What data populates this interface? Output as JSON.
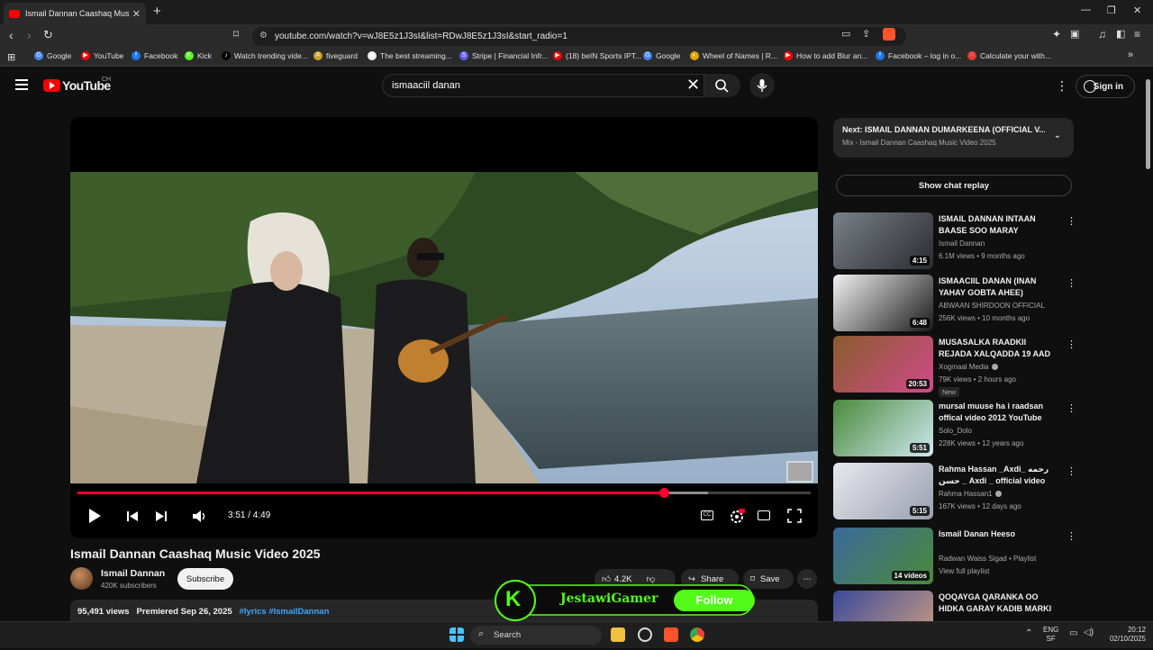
{
  "browser": {
    "tab_title": "Ismail Dannan Caashaq Music Vi",
    "new_tab": "+",
    "win_min": "—",
    "win_max": "❐",
    "win_close": "✕",
    "url": "youtube.com/watch?v=wJ8E5z1J3sI&list=RDwJ8E5z1J3sI&start_radio=1",
    "bookmarks": [
      {
        "label": "Google",
        "color": "#4285f4",
        "glyph": "G"
      },
      {
        "label": "YouTube",
        "color": "#ff0000",
        "glyph": "▶"
      },
      {
        "label": "Facebook",
        "color": "#1877f2",
        "glyph": "f"
      },
      {
        "label": "Kick",
        "color": "#53fc18",
        "glyph": "K"
      },
      {
        "label": "Watch trending vide...",
        "color": "#000000",
        "glyph": "♪"
      },
      {
        "label": "fiveguard",
        "color": "#c9a227",
        "glyph": "#"
      },
      {
        "label": "The best streaming...",
        "color": "#eeeeee",
        "glyph": "◆"
      },
      {
        "label": "Stripe | Financial Infr...",
        "color": "#635bff",
        "glyph": "S"
      },
      {
        "label": "(18) beIN Sports IPT...",
        "color": "#ff0000",
        "glyph": "▶"
      },
      {
        "label": "Google",
        "color": "#4285f4",
        "glyph": "G"
      },
      {
        "label": "Wheel of Names | R...",
        "color": "#e0a800",
        "glyph": "◐"
      },
      {
        "label": "How to add Blur an...",
        "color": "#ff0000",
        "glyph": "▶"
      },
      {
        "label": "Facebook – log in o...",
        "color": "#1877f2",
        "glyph": "f"
      },
      {
        "label": "Calculate your with...",
        "color": "#e53935",
        "glyph": "⁙"
      }
    ],
    "more_bookmarks": "»"
  },
  "youtube": {
    "logo_text": "YouTube",
    "country": "CH",
    "search_value": "ismaaciil danan",
    "sign_in": "Sign in"
  },
  "player": {
    "time": "3:51 / 4:49",
    "progress_fraction": 0.8,
    "buffered_fraction": 0.86,
    "title": "Ismail Dannan Caashaq Music Video 2025",
    "channel": "Ismail Dannan",
    "subscribers": "420K subscribers",
    "subscribe": "Subscribe",
    "likes": "4.2K",
    "share": "Share",
    "save": "Save",
    "views": "95,491 views",
    "premiered": "Premiered Sep 26, 2025",
    "tags": "#lyrics #IsmailDannan"
  },
  "overlay": {
    "streamer": "JestawiGamer",
    "follow": "Follow",
    "brand_glyph": "K"
  },
  "sidebar": {
    "next_title": "Next: ISMAIL DANNAN DUMARKEENA (OFFICIAL V...",
    "next_sub": "Mix - Ismail Dannan Caashaq Music Video 2025",
    "chat_replay": "Show chat replay",
    "videos": [
      {
        "title": "ISMAIL DANNAN INTAAN BAASE SOO MARAY OFFICIAL...",
        "channel": "Ismail Dannan",
        "meta": "6.1M views • 9 months ago",
        "duration": "4:15",
        "verified": false,
        "badge": "",
        "thumb_a": "#7a8088",
        "thumb_b": "#2a2c30"
      },
      {
        "title": "ISMAACIIL DANAN (INAN YAHAY GOBTA AHEE) OFFICIA...",
        "channel": "ABWAAN SHIRDOON OFFICIAL",
        "meta": "256K views • 10 months ago",
        "duration": "6:48",
        "verified": false,
        "badge": "",
        "thumb_a": "#f2f2f2",
        "thumb_b": "#1a1a1a"
      },
      {
        "title": "MUSASALKA RAADKII REJADA XALQADDA 19 AAD",
        "channel": "Xogmaal Media",
        "meta": "79K views • 2 hours ago",
        "duration": "20:53",
        "verified": true,
        "badge": "New",
        "thumb_a": "#8a5c2c",
        "thumb_b": "#d04a8a"
      },
      {
        "title": "mursal muuse ha i raadsan offical video 2012   YouTube",
        "channel": "Solo_Dolo",
        "meta": "228K views • 12 years ago",
        "duration": "5:51",
        "verified": false,
        "badge": "",
        "thumb_a": "#4a8a3a",
        "thumb_b": "#cfe8f0"
      },
      {
        "title": "Rahma Hassan _Axdi_ رحمه حسن _ Axdi _ official video Clip ...",
        "channel": "Rahma Hassan1",
        "meta": "167K views • 12 days ago",
        "duration": "5:15",
        "verified": true,
        "badge": "",
        "thumb_a": "#e8e8ee",
        "thumb_b": "#9aa0b0"
      },
      {
        "title": "Ismail Danan Heeso",
        "channel": "Radwan Waiss Sigad • Playlist",
        "meta": "View full playlist",
        "duration": "14 videos",
        "verified": false,
        "badge": "",
        "thumb_a": "#3a6a9a",
        "thumb_b": "#4a8a3a"
      },
      {
        "title": "QOQAYGA QARANKA OO HIDKA GARAY KADIB MARKI ANKU ...",
        "channel": "",
        "meta": "",
        "duration": "",
        "verified": false,
        "badge": "",
        "thumb_a": "#3a4a9a",
        "thumb_b": "#d0a080"
      }
    ]
  },
  "taskbar": {
    "search": "Search",
    "lang1": "ENG",
    "lang2": "SF",
    "time": "20:12",
    "date": "02/10/2025"
  }
}
